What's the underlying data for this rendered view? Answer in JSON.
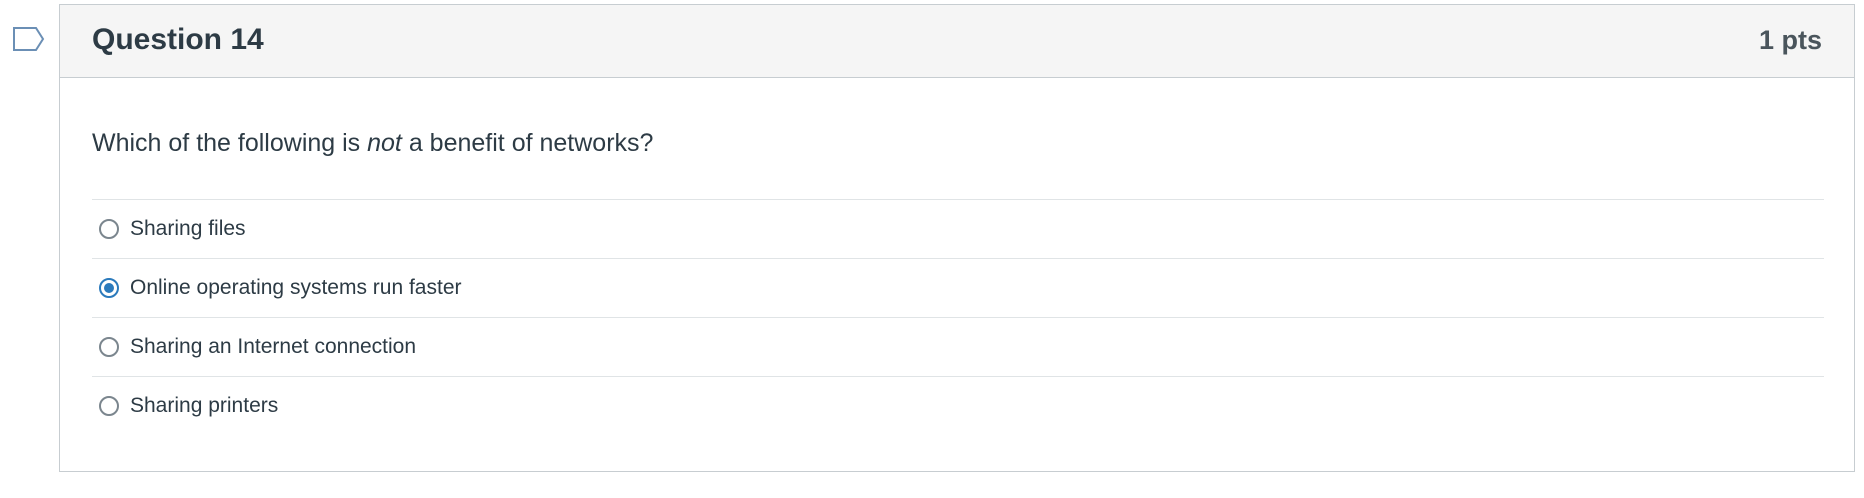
{
  "question": {
    "title": "Question 14",
    "points": "1 pts",
    "text_before": "Which of the following is ",
    "text_emphasis": "not",
    "text_after": " a benefit of networks?"
  },
  "answers": [
    {
      "label": "Sharing files",
      "selected": false
    },
    {
      "label": "Online operating systems run faster",
      "selected": true
    },
    {
      "label": "Sharing an Internet connection",
      "selected": false
    },
    {
      "label": "Sharing printers",
      "selected": false
    }
  ],
  "icons": {
    "flag": "flag-question-icon",
    "radio": "radio-button"
  },
  "colors": {
    "accent": "#2b7abc",
    "flag_stroke": "#6b8fb5",
    "header_bg": "#f5f5f5",
    "border": "#c7cdd1",
    "text": "#2d3b45"
  }
}
